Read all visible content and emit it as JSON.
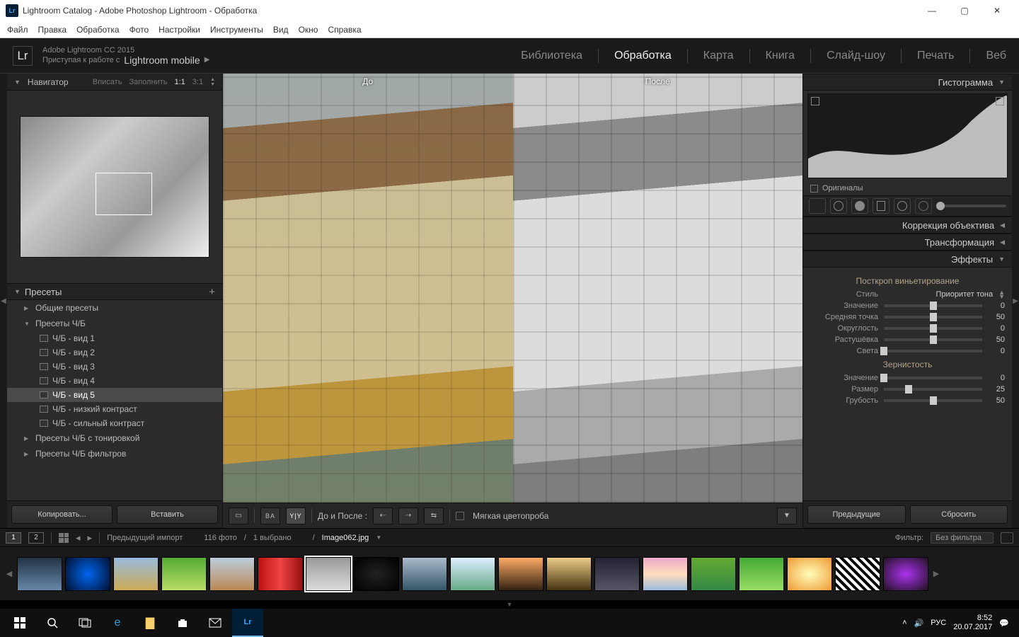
{
  "window": {
    "title": "Lightroom Catalog - Adobe Photoshop Lightroom - Обработка",
    "logo": "Lr"
  },
  "menu": [
    "Файл",
    "Правка",
    "Обработка",
    "Фото",
    "Настройки",
    "Инструменты",
    "Вид",
    "Окно",
    "Справка"
  ],
  "header": {
    "logo": "Lr",
    "product": "Adobe Lightroom CC 2015",
    "subtitle_prefix": "Приступая к работе с",
    "subtitle_mobile": "Lightroom mobile",
    "modules": [
      "Библиотека",
      "Обработка",
      "Карта",
      "Книга",
      "Слайд-шоу",
      "Печать",
      "Веб"
    ],
    "active_module": "Обработка"
  },
  "navigator": {
    "title": "Навигатор",
    "zoom": [
      "Вписать",
      "Заполнить",
      "1:1",
      "3:1"
    ],
    "active_zoom": "1:1"
  },
  "presets": {
    "title": "Пресеты",
    "groups": [
      {
        "label": "Общие пресеты",
        "open": false
      },
      {
        "label": "Пресеты Ч/Б",
        "open": true,
        "items": [
          "Ч/Б - вид 1",
          "Ч/Б - вид 2",
          "Ч/Б - вид 3",
          "Ч/Б - вид 4",
          "Ч/Б - вид 5",
          "Ч/Б - низкий контраст",
          "Ч/Б - сильный контраст"
        ],
        "selected": "Ч/Б - вид 5"
      },
      {
        "label": "Пресеты Ч/Б с тонировкой",
        "open": false
      },
      {
        "label": "Пресеты Ч/Б фильтров",
        "open": false
      }
    ],
    "btn_copy": "Копировать...",
    "btn_paste": "Вставить"
  },
  "compare": {
    "before": "До",
    "after": "После"
  },
  "toolbar": {
    "before_after_label": "До и После :",
    "softproof": "Мягкая цветопроба"
  },
  "right": {
    "histogram_title": "Гистограмма",
    "originals": "Оригиналы",
    "sections": [
      "Коррекция объектива",
      "Трансформация",
      "Эффекты"
    ],
    "effects": {
      "vignette_title": "Посткроп виньетирование",
      "style_label": "Стиль",
      "style_value": "Приоритет тона",
      "vignette_sliders": [
        {
          "label": "Значение",
          "value": 0,
          "pos": 50
        },
        {
          "label": "Средняя точка",
          "value": 50,
          "pos": 50
        },
        {
          "label": "Округлость",
          "value": 0,
          "pos": 50
        },
        {
          "label": "Растушёвка",
          "value": 50,
          "pos": 50
        },
        {
          "label": "Света",
          "value": 0,
          "pos": 0
        }
      ],
      "grain_title": "Зернистость",
      "grain_sliders": [
        {
          "label": "Значение",
          "value": 0,
          "pos": 0
        },
        {
          "label": "Размер",
          "value": 25,
          "pos": 25
        },
        {
          "label": "Грубость",
          "value": 50,
          "pos": 50
        }
      ]
    },
    "btn_prev": "Предыдущие",
    "btn_reset": "Сбросить"
  },
  "secbar": {
    "screens": [
      "1",
      "2"
    ],
    "source": "Предыдущий импорт",
    "count": "116 фото",
    "sep": "/",
    "selected": "1 выбрано",
    "filepath_sep": "/",
    "filename": "Image062.jpg",
    "filter_label": "Фильтр:",
    "filter_value": "Без фильтра"
  },
  "taskbar": {
    "lang": "РУС",
    "time": "8:52",
    "date": "20.07.2017"
  }
}
